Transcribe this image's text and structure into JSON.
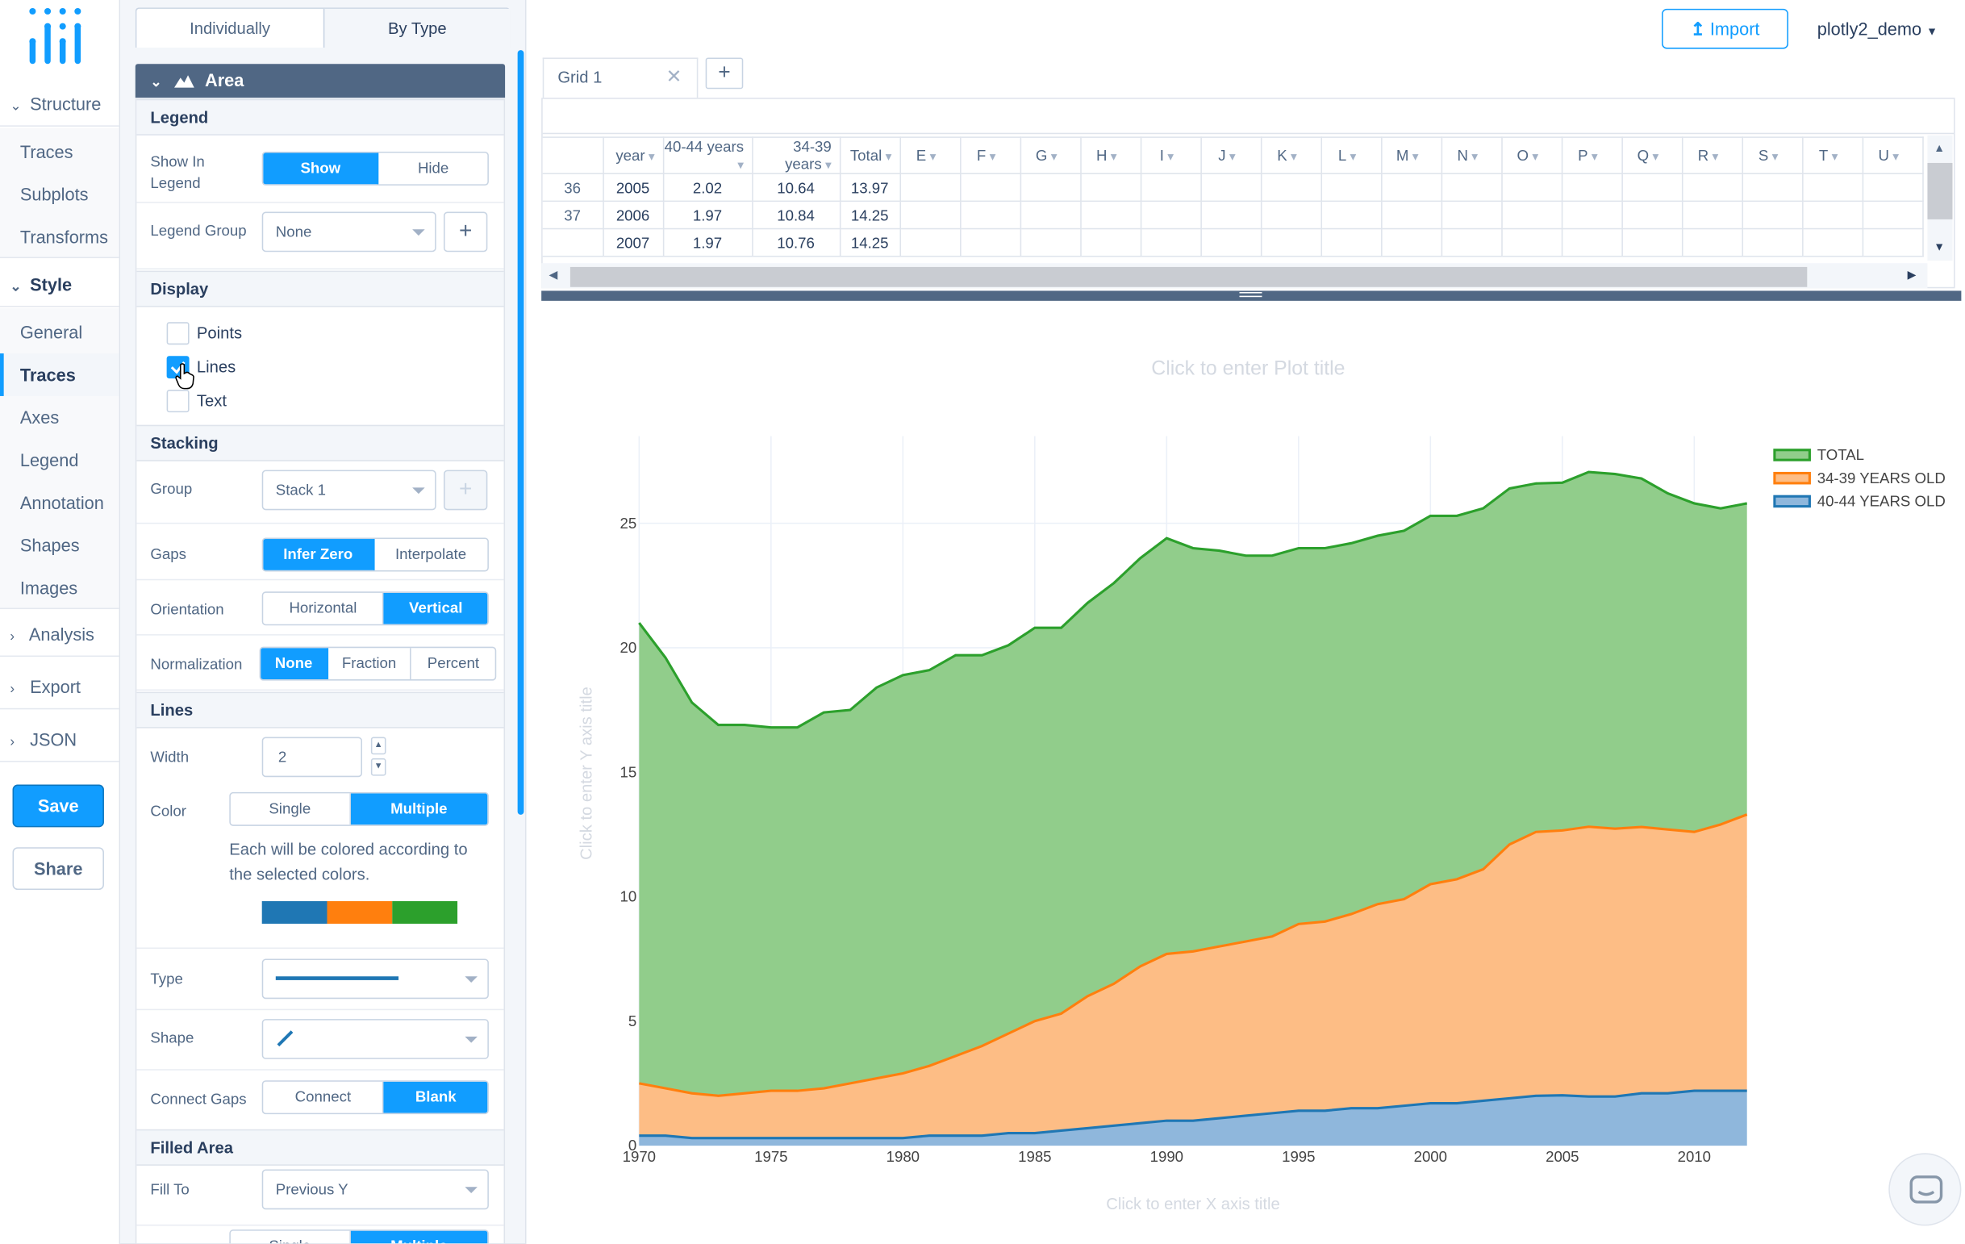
{
  "nav": {
    "structure": "Structure",
    "structure_items": [
      "Traces",
      "Subplots",
      "Transforms"
    ],
    "style": "Style",
    "style_items": [
      "General",
      "Traces",
      "Axes",
      "Legend",
      "Annotation",
      "Shapes",
      "Images"
    ],
    "analysis": "Analysis",
    "export": "Export",
    "json": "JSON",
    "save": "Save",
    "share": "Share"
  },
  "panel": {
    "tabs": [
      "Individually",
      "By Type"
    ],
    "fold_title": "Area",
    "legend_section": "Legend",
    "show_in_legend_label": "Show In Legend",
    "show_in_legend_options": [
      "Show",
      "Hide"
    ],
    "legend_group_label": "Legend Group",
    "legend_group_value": "None",
    "display_section": "Display",
    "display_options": [
      "Points",
      "Lines",
      "Text"
    ],
    "display_checked": [
      false,
      true,
      false
    ],
    "stacking_section": "Stacking",
    "group_label": "Group",
    "group_value": "Stack 1",
    "gaps_label": "Gaps",
    "gaps_options": [
      "Infer Zero",
      "Interpolate"
    ],
    "orientation_label": "Orientation",
    "orientation_options": [
      "Horizontal",
      "Vertical"
    ],
    "normalization_label": "Normalization",
    "normalization_options": [
      "None",
      "Fraction",
      "Percent"
    ],
    "lines_section": "Lines",
    "width_label": "Width",
    "width_value": "2",
    "color_label": "Color",
    "color_options": [
      "Single",
      "Multiple"
    ],
    "color_note": "Each will be colored according to the selected colors.",
    "palette": [
      "#1f77b4",
      "#ff7f0e",
      "#2ca02c"
    ],
    "type_label": "Type",
    "shape_label": "Shape",
    "connect_gaps_label": "Connect Gaps",
    "connect_gaps_options": [
      "Connect",
      "Blank"
    ],
    "filled_area_section": "Filled Area",
    "fill_to_label": "Fill To",
    "fill_to_value": "Previous Y",
    "fill_color_options": [
      "Single",
      "Multiple"
    ]
  },
  "topbar": {
    "import": "Import",
    "user": "plotly2_demo"
  },
  "grid": {
    "tab": "Grid 1",
    "add": "+",
    "columns": [
      "year",
      "40-44 years",
      "34-39 years",
      "Total",
      "E",
      "F",
      "G",
      "H",
      "I",
      "J",
      "K",
      "L",
      "M",
      "N",
      "O",
      "P",
      "Q",
      "R",
      "S",
      "T",
      "U"
    ],
    "rows": [
      {
        "num": "36",
        "cells": [
          "2005",
          "2.02",
          "10.64",
          "13.97"
        ]
      },
      {
        "num": "37",
        "cells": [
          "2006",
          "1.97",
          "10.84",
          "14.25"
        ]
      },
      {
        "num": "",
        "cells": [
          "2007",
          "1.97",
          "10.76",
          "14.25"
        ]
      }
    ]
  },
  "plot": {
    "title_placeholder": "Click to enter Plot title",
    "xaxis_placeholder": "Click to enter X axis title",
    "yaxis_placeholder": "Click to enter Y axis title"
  },
  "chart_data": {
    "type": "area",
    "stacked": true,
    "title": "",
    "xlabel": "",
    "ylabel": "",
    "xlim": [
      1970,
      2012
    ],
    "ylim": [
      0,
      28.5
    ],
    "x_ticks": [
      1970,
      1975,
      1980,
      1985,
      1990,
      1995,
      2000,
      2005,
      2010
    ],
    "y_ticks": [
      0,
      5,
      10,
      15,
      20,
      25
    ],
    "legend_position": "top-right",
    "grid": true,
    "x": [
      1970,
      1971,
      1972,
      1973,
      1974,
      1975,
      1976,
      1977,
      1978,
      1979,
      1980,
      1981,
      1982,
      1983,
      1984,
      1985,
      1986,
      1987,
      1988,
      1989,
      1990,
      1991,
      1992,
      1993,
      1994,
      1995,
      1996,
      1997,
      1998,
      1999,
      2000,
      2001,
      2002,
      2003,
      2004,
      2005,
      2006,
      2007,
      2008,
      2009,
      2010,
      2011,
      2012
    ],
    "series": [
      {
        "name": "40-44 YEARS OLD",
        "color": "#1f77b4",
        "fill": "#8fb7dc",
        "values": [
          0.4,
          0.4,
          0.3,
          0.3,
          0.3,
          0.3,
          0.3,
          0.3,
          0.3,
          0.3,
          0.3,
          0.4,
          0.4,
          0.4,
          0.5,
          0.5,
          0.6,
          0.7,
          0.8,
          0.9,
          1.0,
          1.0,
          1.1,
          1.2,
          1.3,
          1.4,
          1.4,
          1.5,
          1.5,
          1.6,
          1.7,
          1.7,
          1.8,
          1.9,
          2.0,
          2.02,
          1.97,
          1.97,
          2.1,
          2.1,
          2.2,
          2.2,
          2.2
        ]
      },
      {
        "name": "34-39 YEARS OLD",
        "color": "#ff7f0e",
        "fill": "#fdbd85",
        "values": [
          2.1,
          1.9,
          1.8,
          1.7,
          1.8,
          1.9,
          1.9,
          2.0,
          2.2,
          2.4,
          2.6,
          2.8,
          3.2,
          3.6,
          4.0,
          4.5,
          4.7,
          5.3,
          5.7,
          6.3,
          6.7,
          6.8,
          6.9,
          7.0,
          7.1,
          7.5,
          7.6,
          7.8,
          8.2,
          8.3,
          8.8,
          9.0,
          9.3,
          10.2,
          10.6,
          10.64,
          10.84,
          10.76,
          10.7,
          10.6,
          10.4,
          10.7,
          11.1
        ]
      },
      {
        "name": "TOTAL",
        "color": "#2ca02c",
        "fill": "#91cd8b",
        "values": [
          18.5,
          17.3,
          15.7,
          14.9,
          14.8,
          14.6,
          14.6,
          15.1,
          15.0,
          15.7,
          16.0,
          15.9,
          16.1,
          15.7,
          15.6,
          15.8,
          15.5,
          15.8,
          16.1,
          16.4,
          16.7,
          16.2,
          15.9,
          15.5,
          15.3,
          15.1,
          15.0,
          14.9,
          14.8,
          14.8,
          14.8,
          14.6,
          14.5,
          14.3,
          14.0,
          13.97,
          14.25,
          14.25,
          14.0,
          13.5,
          13.2,
          12.7,
          12.5
        ]
      }
    ]
  }
}
